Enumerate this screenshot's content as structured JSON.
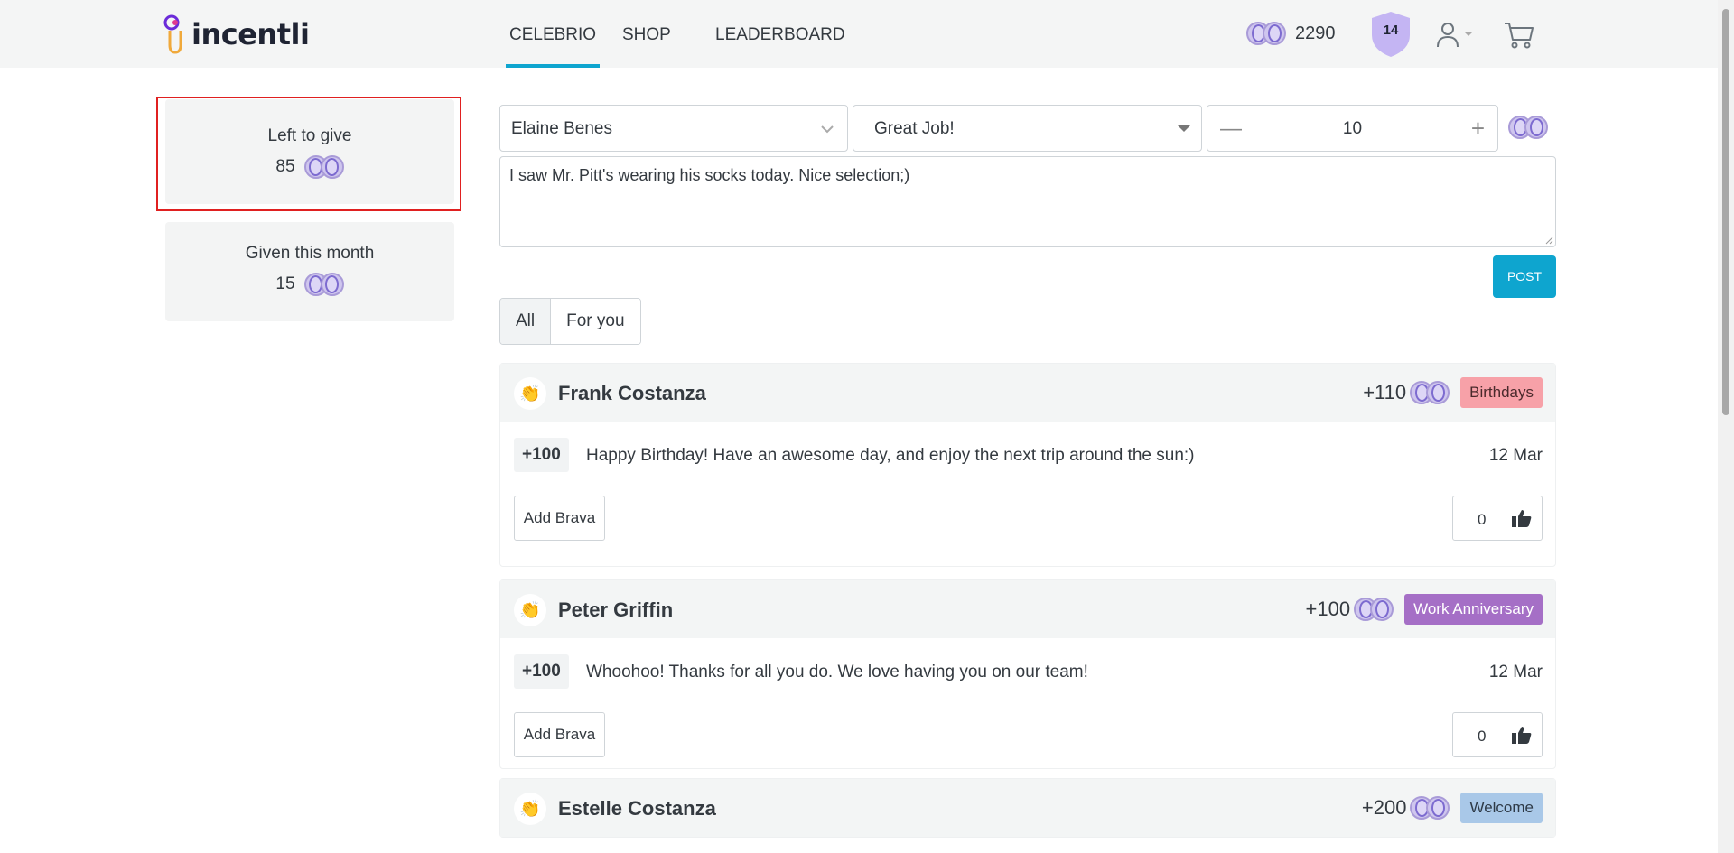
{
  "header": {
    "logo_text": "incentli",
    "nav": [
      {
        "label": "CELEBRIO",
        "active": true
      },
      {
        "label": "SHOP",
        "active": false
      },
      {
        "label": "LEADERBOARD",
        "active": false
      }
    ],
    "balance": "2290",
    "level": "14",
    "icons": [
      "coin-icon",
      "shield-icon",
      "user-icon",
      "chevron-down-icon",
      "cart-icon"
    ]
  },
  "sidebar": {
    "left_to_give": {
      "label": "Left to give",
      "value": "85"
    },
    "given_this_month": {
      "label": "Given this month",
      "value": "15"
    }
  },
  "compose": {
    "recipient": "Elaine Benes",
    "award_type": "Great Job!",
    "amount": "10",
    "message": "I saw Mr. Pitt's wearing his socks today.  Nice selection;)",
    "post_label": "POST"
  },
  "tabs": [
    {
      "label": "All",
      "active": true
    },
    {
      "label": "For you",
      "active": false
    }
  ],
  "feed": [
    {
      "name": "Frank Costanza",
      "points": "+110",
      "category": "Birthdays",
      "category_color": "#f7a1a8",
      "entry_amount": "+100",
      "message": "Happy Birthday! Have an awesome day, and enjoy the next trip around the sun:)",
      "date": "12 Mar",
      "add_label": "Add Brava",
      "likes": "0"
    },
    {
      "name": "Peter Griffin",
      "points": "+100",
      "category": "Work Anniversary",
      "category_color": "#a56fc6",
      "entry_amount": "+100",
      "message": "Whoohoo! Thanks for all you do. We love having you on our team!",
      "date": "12 Mar",
      "add_label": "Add Brava",
      "likes": "0"
    },
    {
      "name": "Estelle Costanza",
      "points": "+200",
      "category": "Welcome",
      "category_color": "#a9c8e8"
    }
  ],
  "colors": {
    "accent": "#0ea5cf",
    "highlight": "#e02020",
    "coin": "#cfc6ee"
  }
}
